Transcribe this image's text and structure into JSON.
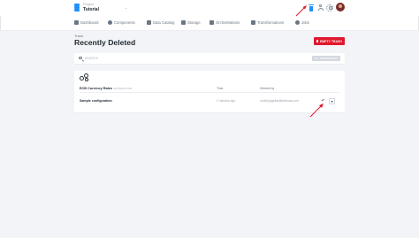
{
  "project": {
    "label": "Project",
    "name": "Tutorial"
  },
  "nav": {
    "items": [
      {
        "label": "Dashboard",
        "icon": "dashboard-icon"
      },
      {
        "label": "Components",
        "icon": "components-icon"
      },
      {
        "label": "Data Catalog",
        "icon": "data-catalog-icon"
      },
      {
        "label": "Storage",
        "icon": "storage-icon"
      },
      {
        "label": "Orchestrations",
        "icon": "orchestrations-icon"
      },
      {
        "label": "Transformations",
        "icon": "transformations-icon"
      },
      {
        "label": "Jobs",
        "icon": "jobs-icon"
      }
    ]
  },
  "page": {
    "breadcrumb": "Trash",
    "title": "Recently Deleted",
    "empty_button": "EMPTY TRASH"
  },
  "search": {
    "placeholder": "SEARCH",
    "filter_button": "ALL COMPONENTS"
  },
  "table": {
    "component_name": "ECB Currency Rates",
    "component_type": "EXTRACTOR",
    "col_time": "Time",
    "col_deleted_by": "Deleted by",
    "rows": [
      {
        "name": "Sample configuration",
        "time": "2 minutes ago",
        "deleted_by": "ondrej.jagelka@keboola.com"
      }
    ]
  },
  "colors": {
    "accent": "#1f8fff",
    "danger": "#e0182d",
    "annotation": "#e0182d"
  }
}
